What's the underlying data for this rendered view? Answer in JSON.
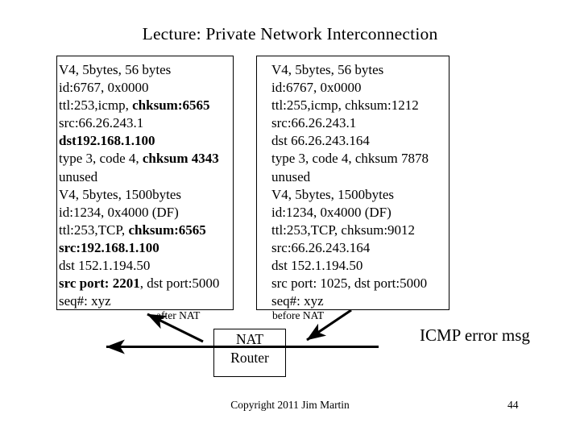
{
  "slide": {
    "title": "Lecture: Private Network Interconnection"
  },
  "left_packet": {
    "name": "after-nat-packet",
    "lines": [
      [
        {
          "t": "V4, 5bytes, 56 bytes",
          "bold": false
        }
      ],
      [
        {
          "t": "id:6767,    0x0000",
          "bold": false
        }
      ],
      [
        {
          "t": "ttl:253,icmp, ",
          "bold": false
        },
        {
          "t": "chksum:6565",
          "bold": true
        }
      ],
      [
        {
          "t": "src:66.26.243.1",
          "bold": false
        }
      ],
      [
        {
          "t": "dst192.168.1.100",
          "bold": true
        }
      ],
      [
        {
          "t": "type 3, code 4, ",
          "bold": false
        },
        {
          "t": "chksum 4343",
          "bold": true
        }
      ],
      [
        {
          "t": "unused",
          "bold": false
        }
      ],
      [
        {
          "t": "V4, 5bytes, 1500bytes",
          "bold": false
        }
      ],
      [
        {
          "t": "id:1234,    0x4000 (DF)",
          "bold": false
        }
      ],
      [
        {
          "t": "ttl:253,TCP, ",
          "bold": false
        },
        {
          "t": "chksum:6565",
          "bold": true
        }
      ],
      [
        {
          "t": "src:192.168.1.100",
          "bold": true
        }
      ],
      [
        {
          "t": "dst 152.1.194.50",
          "bold": false
        }
      ],
      [
        {
          "t": "src port: 2201",
          "bold": true
        },
        {
          "t": ", dst port:5000",
          "bold": false
        }
      ],
      [
        {
          "t": "seq#: xyz",
          "bold": false
        }
      ]
    ]
  },
  "right_packet": {
    "name": "before-nat-packet",
    "lines": [
      [
        {
          "t": "V4, 5bytes, 56 bytes",
          "bold": false
        }
      ],
      [
        {
          "t": "id:6767,    0x0000",
          "bold": false
        }
      ],
      [
        {
          "t": "ttl:255,icmp, chksum:1212",
          "bold": false
        }
      ],
      [
        {
          "t": "src:66.26.243.1",
          "bold": false
        }
      ],
      [
        {
          "t": "dst 66.26.243.164",
          "bold": false
        }
      ],
      [
        {
          "t": "type 3, code 4, chksum 7878",
          "bold": false
        }
      ],
      [
        {
          "t": "unused",
          "bold": false
        }
      ],
      [
        {
          "t": "V4, 5bytes, 1500bytes",
          "bold": false
        }
      ],
      [
        {
          "t": "id:1234,    0x4000 (DF)",
          "bold": false
        }
      ],
      [
        {
          "t": "ttl:253,TCP, chksum:9012",
          "bold": false
        }
      ],
      [
        {
          "t": "src:66.26.243.164",
          "bold": false
        }
      ],
      [
        {
          "t": "dst 152.1.194.50",
          "bold": false
        }
      ],
      [
        {
          "t": "src port: 1025, dst port:5000",
          "bold": false
        }
      ],
      [
        {
          "t": "seq#: xyz",
          "bold": false
        }
      ]
    ]
  },
  "diagram": {
    "nat_router_line1": "NAT",
    "nat_router_line2": "Router",
    "label_after_nat": "after NAT",
    "label_before_nat": "before NAT",
    "icmp_error_msg": "ICMP error msg"
  },
  "footer": {
    "copyright": "Copyright 2011 Jim Martin",
    "page_number": "44"
  },
  "colors": {
    "ink": "#000000",
    "background": "#ffffff"
  }
}
